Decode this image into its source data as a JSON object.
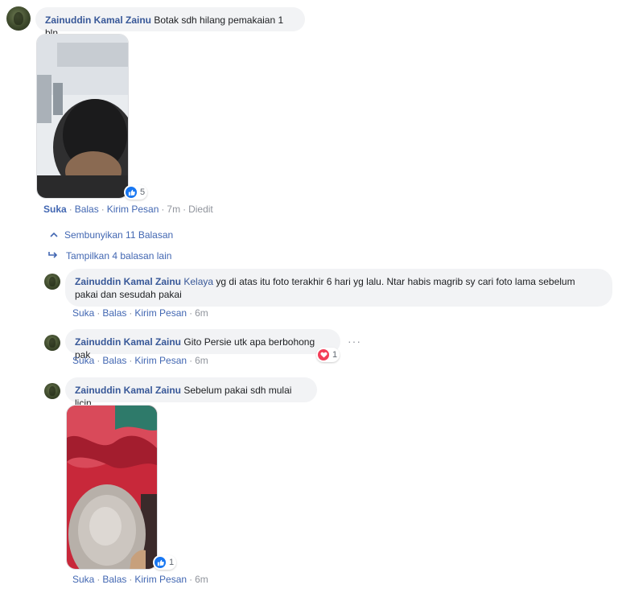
{
  "comment1": {
    "author": "Zainuddin Kamal Zainu",
    "text": "Botak sdh hilang pemakaian 1 bln",
    "reaction_count": "5",
    "actions": {
      "like": "Suka",
      "reply": "Balas",
      "message": "Kirim Pesan",
      "time": "7m",
      "edited": "Diedit"
    }
  },
  "hide_replies": "Sembunyikan 11 Balasan",
  "show_more": "Tampilkan 4 balasan lain",
  "reply1": {
    "author": "Zainuddin Kamal Zainu",
    "mention": "Kelaya",
    "text_line1": " yg di atas itu foto terakhir 6 hari yg lalu. Ntar habis magrib sy cari foto lama sebelum",
    "text_line2": "pakai dan sesudah pakai",
    "actions": {
      "like": "Suka",
      "reply": "Balas",
      "message": "Kirim Pesan",
      "time": "6m"
    }
  },
  "reply2": {
    "author": "Zainuddin Kamal Zainu",
    "text": "Gito Persie utk apa berbohong pak",
    "reaction_count": "1",
    "more": "···",
    "actions": {
      "like": "Suka",
      "reply": "Balas",
      "message": "Kirim Pesan",
      "time": "6m"
    }
  },
  "reply3": {
    "author": "Zainuddin Kamal Zainu",
    "text": "Sebelum pakai sdh mulai licin",
    "reaction_count": "1",
    "actions": {
      "like": "Suka",
      "reply": "Balas",
      "message": "Kirim Pesan",
      "time": "6m"
    }
  },
  "colors": {
    "link": "#385898",
    "action": "#4267b2",
    "bubble": "#f2f3f5",
    "like": "#1877f2",
    "love": "#f33e58",
    "meta": "#90949c"
  }
}
